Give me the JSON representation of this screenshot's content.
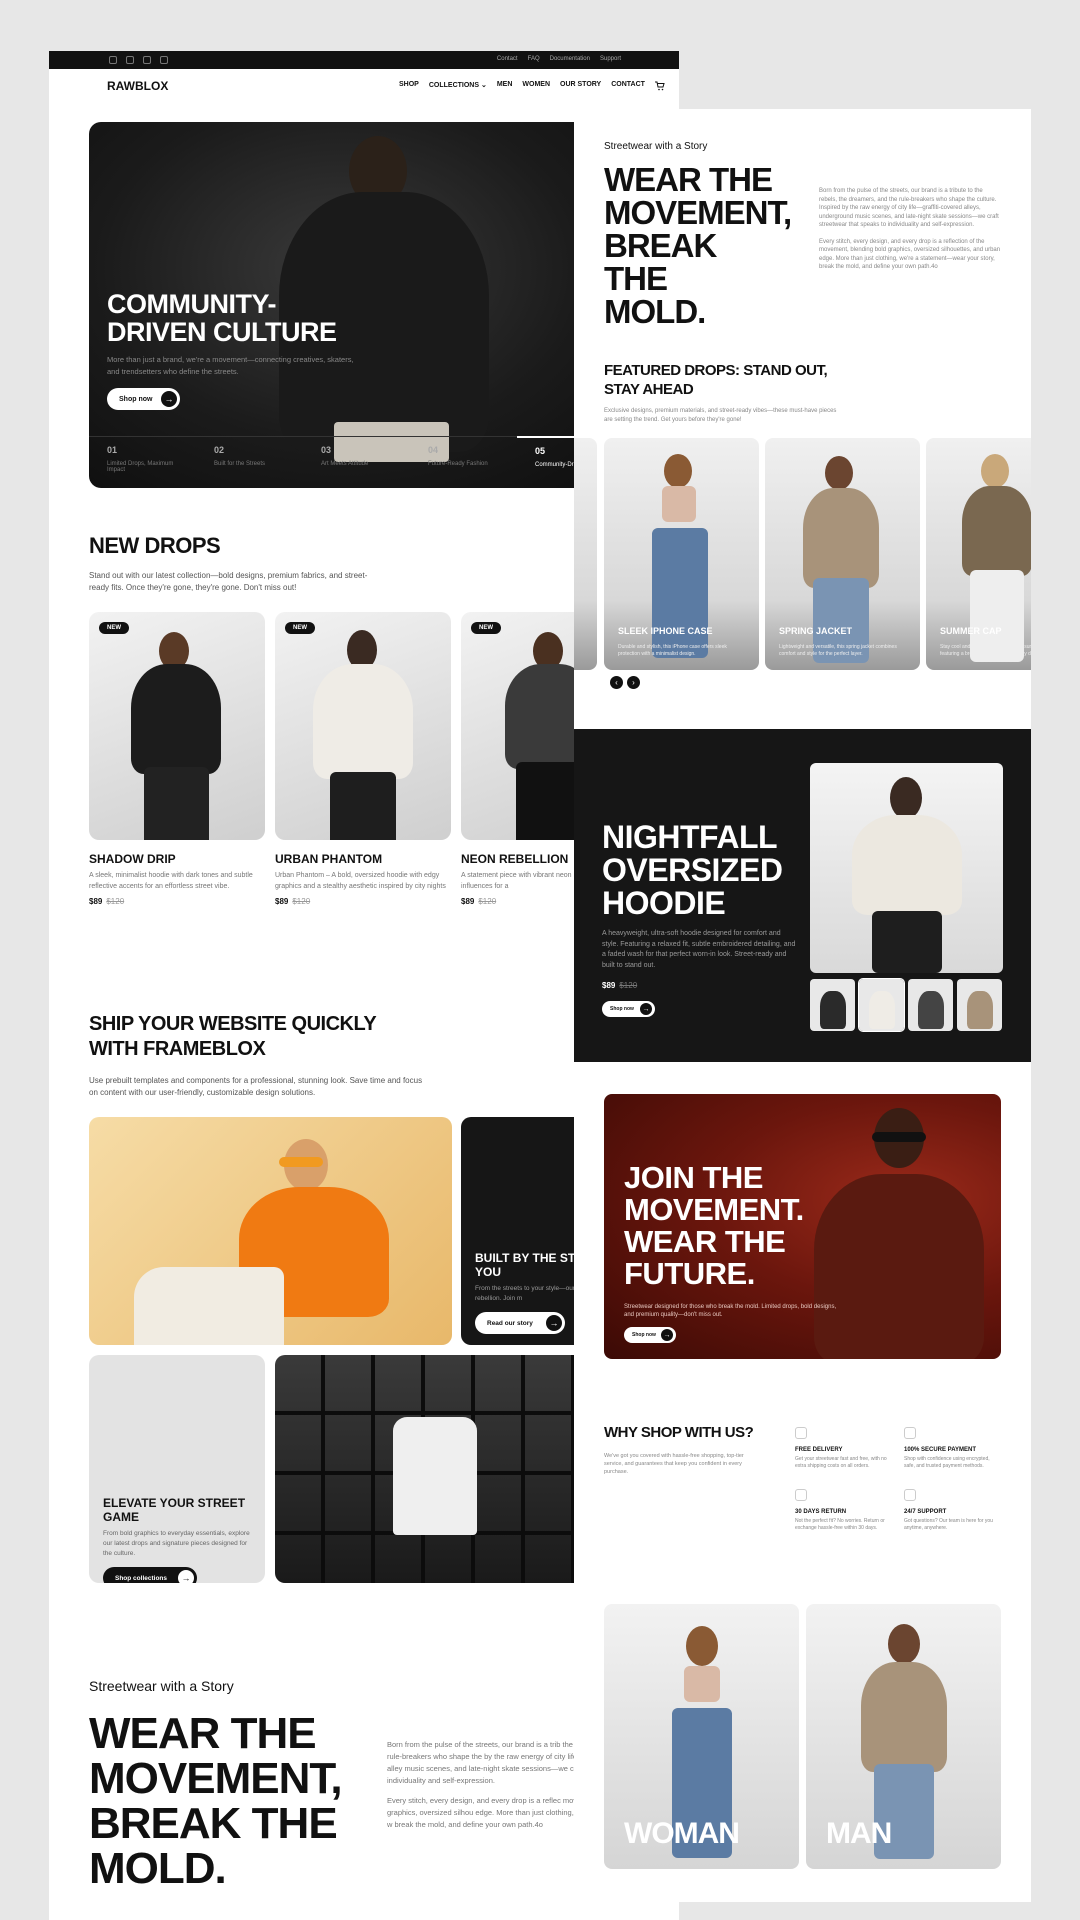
{
  "topbar": {
    "links": [
      "Contact",
      "FAQ",
      "Documentation",
      "Support"
    ]
  },
  "nav": {
    "logo": "RAWBLOX",
    "links": [
      "SHOP",
      "COLLECTIONS",
      "MEN",
      "WOMEN",
      "OUR STORY",
      "CONTACT"
    ],
    "cart_icon": "cart-icon"
  },
  "hero": {
    "title": "COMMUNITY-DRIVEN CULTURE",
    "subtitle": "More than just a brand, we're a movement—connecting creatives, skaters, and trendsetters who define the streets.",
    "button": "Shop now",
    "steps": [
      {
        "num": "01",
        "label": "Limited Drops, Maximum Impact"
      },
      {
        "num": "02",
        "label": "Built for the Streets"
      },
      {
        "num": "03",
        "label": "Art Meets Attitude"
      },
      {
        "num": "04",
        "label": "Future-Ready Fashion"
      },
      {
        "num": "05",
        "label": "Community-Dr"
      }
    ]
  },
  "new_drops": {
    "title": "NEW DROPS",
    "subtitle": "Stand out with our latest collection—bold designs, premium fabrics, and street-ready fits. Once they're gone, they're gone. Don't miss out!",
    "products": [
      {
        "badge": "NEW",
        "name": "SHADOW DRIP",
        "desc": "A sleek, minimalist hoodie with dark tones and subtle reflective accents for an effortless street vibe.",
        "price": "$89",
        "old_price": "$120"
      },
      {
        "badge": "NEW",
        "name": "URBAN PHANTOM",
        "desc": "Urban Phantom – A bold, oversized hoodie with edgy graphics and a stealthy aesthetic inspired by city nights",
        "price": "$89",
        "old_price": "$120"
      },
      {
        "badge": "NEW",
        "name": "NEON REBELLION",
        "desc": "A statement piece with vibrant neon rebellious street art influences for a",
        "price": "$89",
        "old_price": "$120"
      }
    ]
  },
  "ship": {
    "title": "SHIP YOUR WEBSITE QUICKLY WITH FRAMEBLOX",
    "subtitle": "Use prebuilt templates and components for a professional, stunning look. Save time and focus on content with our user-friendly, customizable design solutions.",
    "tile_dark": {
      "title": "BUILT BY THE STREET FOR YOU",
      "text": "From the streets to your style—our self-expression and rebellion. Join m",
      "button": "Read our story"
    },
    "tile_light": {
      "title": "ELEVATE YOUR STREET GAME",
      "text": "From bold graphics to everyday essentials, explore our latest drops and signature pieces designed for the culture.",
      "button": "Shop collections"
    }
  },
  "story_left": {
    "eyebrow": "Streetwear with a Story",
    "title": "WEAR THE MOVEMENT, BREAK THE MOLD.",
    "p1": "Born from the pulse of the streets, our brand is a trib the dreamers, and the rule-breakers who shape the by the raw energy of city life—graffiti-covered alley music scenes, and late-night skate sessions—we cr that speaks to individuality and self-expression.",
    "p2": "Every stitch, every design, and every drop is a reflec movement, blending bold graphics, oversized silhou edge. More than just clothing, we're a statement—w break the mold, and define your own path.4o"
  },
  "story_right": {
    "eyebrow": "Streetwear with a Story",
    "title": "WEAR THE MOVEMENT, BREAK THE MOLD.",
    "p1": "Born from the pulse of the streets, our brand is a tribute to the rebels, the dreamers, and the rule-breakers who shape the culture. Inspired by the raw energy of city life—graffiti-covered alleys, underground music scenes, and late-night skate sessions—we craft streetwear that speaks to individuality and self-expression.",
    "p2": "Every stitch, every design, and every drop is a reflection of the movement, blending bold graphics, oversized silhouettes, and urban edge. More than just clothing, we're a statement—wear your story, break the mold, and define your own path.4o"
  },
  "featured": {
    "title": "FEATURED DROPS: STAND OUT, STAY AHEAD",
    "subtitle": "Exclusive designs, premium materials, and street-ready vibes—these must-have pieces are setting the trend. Get yours before they're gone!",
    "cards": [
      {
        "name": "SLEEK IPHONE CASE",
        "desc": "Durable and stylish, this iPhone case offers sleek protection with a minimalist design."
      },
      {
        "name": "SPRING JACKET",
        "desc": "Lightweight and versatile, this spring jacket combines comfort and style for the perfect layer."
      },
      {
        "name": "SUMMER CAP",
        "desc": "Stay cool and shaded with this stylish summer cap, featuring a breathable design for sunny days."
      }
    ]
  },
  "nightfall": {
    "title": "NIGHTFALL OVERSIZED HOODIE",
    "desc": "A heavyweight, ultra-soft hoodie designed for comfort and style. Featuring a relaxed fit, subtle embroidered detailing, and a faded wash for that perfect worn-in look. Street-ready and built to stand out.",
    "price": "$89",
    "old_price": "$120",
    "button": "Shop now"
  },
  "join": {
    "title": "JOIN THE MOVEMENT. WEAR THE FUTURE.",
    "desc": "Streetwear designed for those who break the mold. Limited drops, bold designs, and premium quality—don't miss out.",
    "button": "Shop now"
  },
  "why": {
    "title": "WHY SHOP WITH US?",
    "subtitle": "We've got you covered with hassle-free shopping, top-tier service, and guarantees that keep you confident in every purchase.",
    "features": [
      {
        "title": "FREE DELIVERY",
        "text": "Get your streetwear fast and free, with no extra shipping costs on all orders."
      },
      {
        "title": "100% SECURE PAYMENT",
        "text": "Shop with confidence using encrypted, safe, and trusted payment methods."
      },
      {
        "title": "30 DAYS RETURN",
        "text": "Not the perfect fit? No worries. Return or exchange hassle-free within 30 days."
      },
      {
        "title": "24/7 SUPPORT",
        "text": "Got questions? Our team is here for you anytime, anywhere."
      }
    ]
  },
  "gender": {
    "woman": "WOMAN",
    "man": "MAN"
  }
}
